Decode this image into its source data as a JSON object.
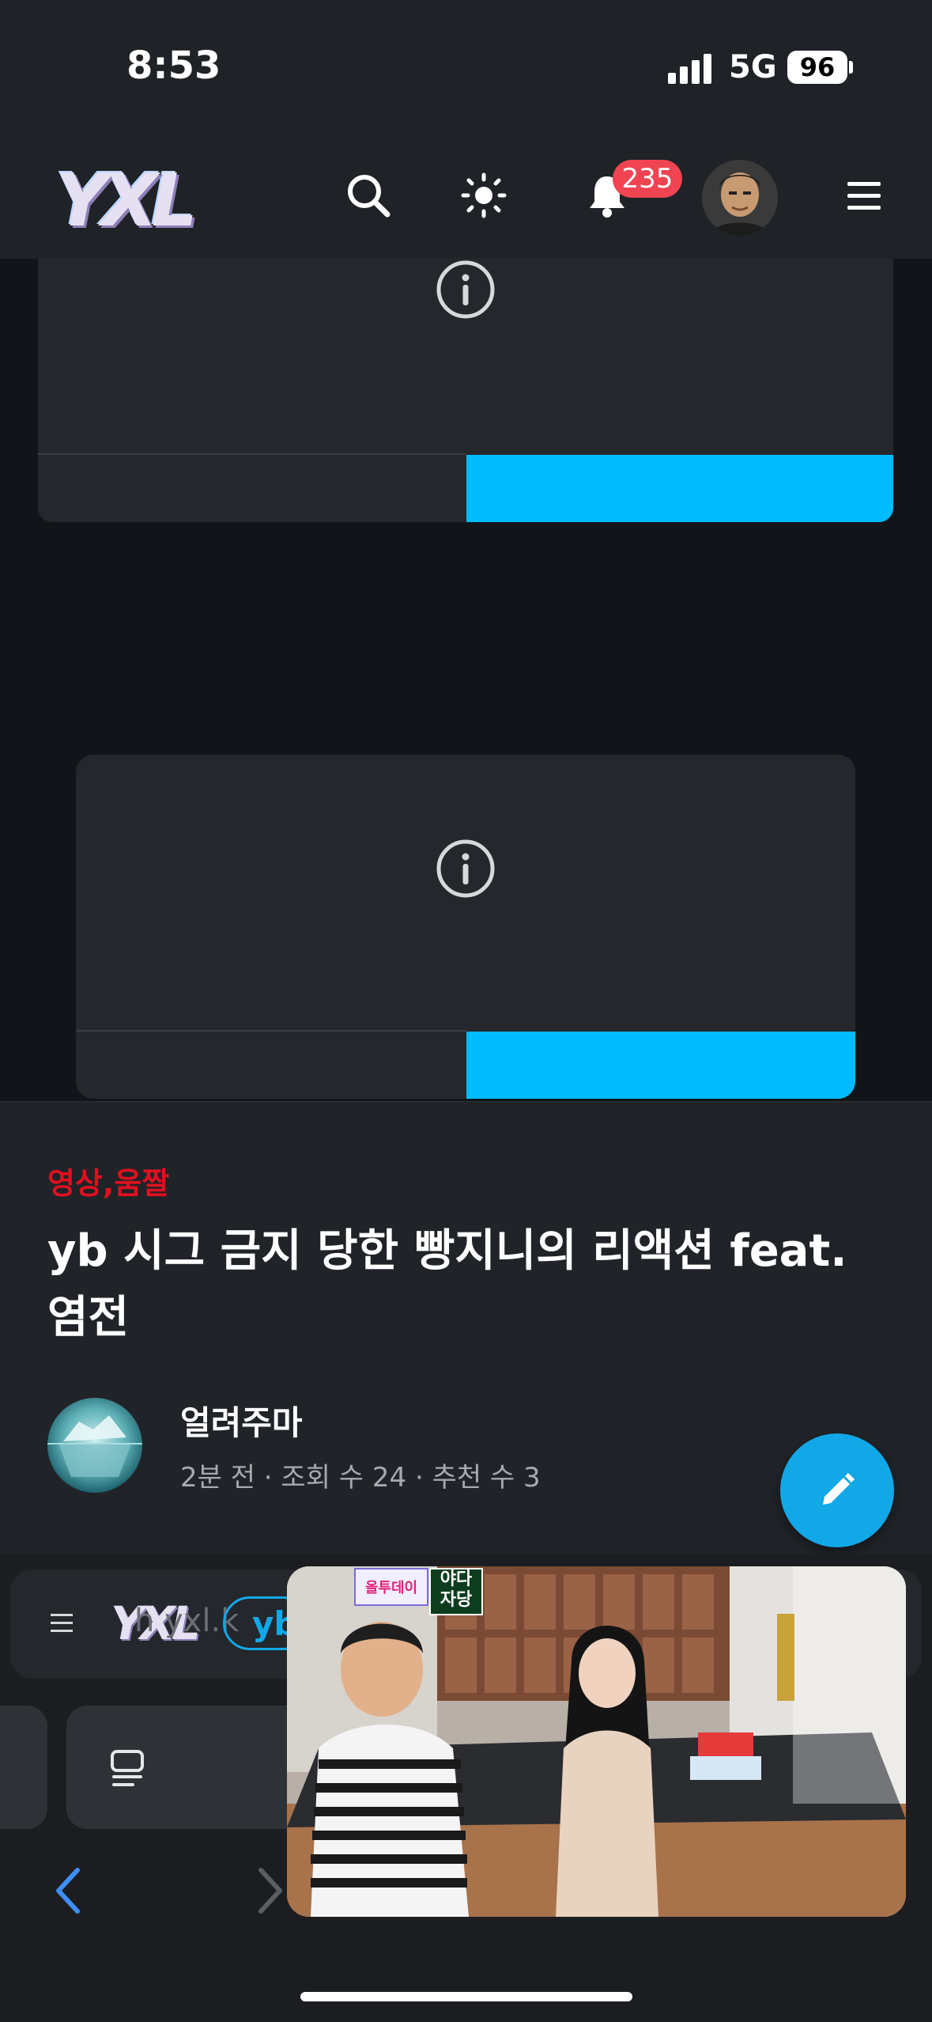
{
  "status_bar": {
    "time": "8:53",
    "network": "5G",
    "battery": "96"
  },
  "header": {
    "logo": "YXL",
    "notification_count": "235"
  },
  "article": {
    "category": "영상,움짤",
    "title_line1": "yb 시그 금지 당한 빵지니의 리액션 feat.",
    "title_line2": "염전",
    "author": "얼려주마",
    "meta": "2분 전 · 조회 수 24 · 추천 수 3"
  },
  "browser": {
    "url_logo": "YXL",
    "url_fragment": "h   yxl.k",
    "url_chip": "yb"
  },
  "pip": {
    "sticker_top": "올투데이",
    "sticker_right": "야다\n자당"
  },
  "colors": {
    "accent": "#00bbff",
    "category_red": "#e0101f",
    "badge_red": "#f04452"
  }
}
